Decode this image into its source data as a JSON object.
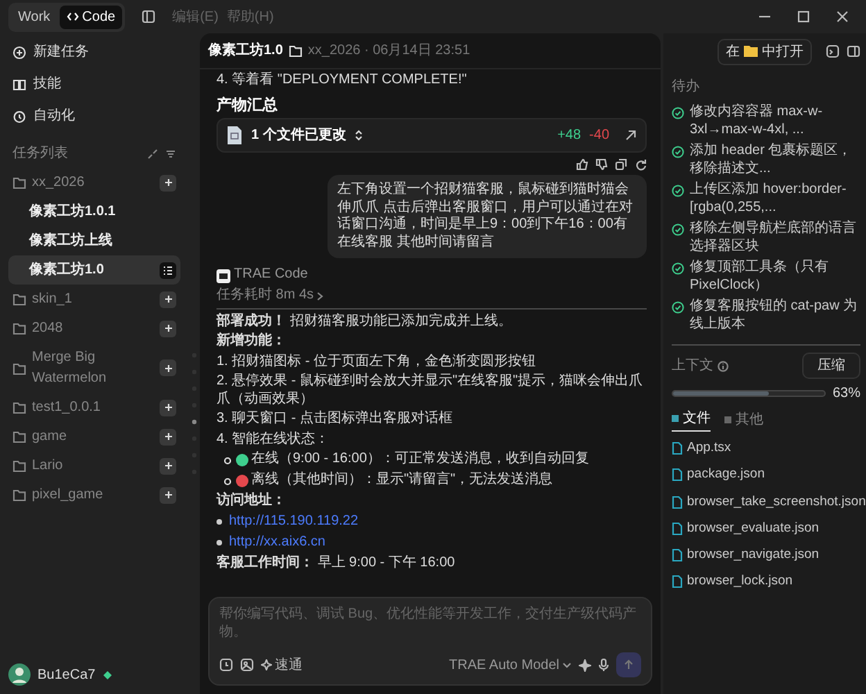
{
  "top_bar": {
    "mode_tabs": [
      {
        "label": "Work",
        "selected": false
      },
      {
        "label": "Code",
        "selected": true
      }
    ],
    "menu": [
      "编辑(E)",
      "帮助(H)"
    ]
  },
  "sidebar": {
    "actions": [
      {
        "label": "新建任务",
        "kind": "new"
      },
      {
        "label": "技能",
        "kind": "skills"
      },
      {
        "label": "自动化",
        "kind": "automation"
      }
    ],
    "task_list_title": "任务列表",
    "projects": [
      {
        "label": "xx_2026",
        "children": [
          {
            "label": "像素工坊1.0.1",
            "selected": false
          },
          {
            "label": "像素工坊上线",
            "selected": false
          },
          {
            "label": "像素工坊1.0",
            "selected": true
          }
        ]
      },
      {
        "label": "skin_1"
      },
      {
        "label": "2048"
      },
      {
        "label": "Merge Big Watermelon"
      },
      {
        "label": "test1_0.0.1"
      },
      {
        "label": "game"
      },
      {
        "label": "Lario"
      },
      {
        "label": "pixel_game"
      }
    ],
    "user": {
      "name": "Bu1eCa7"
    }
  },
  "task": {
    "title": "像素工坊1.0",
    "meta": "xx_2026 · 06月14日 23:51",
    "open_before": "在",
    "open_after": "中打开"
  },
  "conversation": {
    "earlier_step": "4. 等着看 \"DEPLOYMENT COMPLETE!\"",
    "summary": {
      "heading": "产物汇总",
      "files_changed": "1 个文件已更改",
      "added": "+48",
      "removed": "-40"
    },
    "user_message": "左下角设置一个招财猫客服，鼠标碰到猫时猫会伸爪爪 点击后弹出客服窗口，用户可以通过在对话窗口沟通，时间是早上9：00到下午16：00有在线客服 其他时间请留言",
    "assistant": {
      "name": "TRAE Code",
      "duration": "任务耗时 8m 4s",
      "success": "**部署成功！** 招财猫客服功能已添加完成并上线。",
      "features_heading": "新增功能：",
      "features": [
        "1. 招财猫图标 - 位于页面左下角，金色渐变圆形按钮",
        "2. 悬停效果 - 鼠标碰到时会放大并显示\"在线客服\"提示，猫咪会伸出爪爪（动画效果）",
        "3. 聊天窗口 - 点击图标弹出客服对话框",
        "4. 智能在线状态："
      ],
      "status_items": [
        {
          "text": "在线（9:00 - 16:00）：可正常发送消息，收到自动回复",
          "color": "#3ecf8e"
        },
        {
          "text": "离线（其他时间）：显示\"请留言\"，无法发送消息",
          "color": "#e5484d"
        }
      ],
      "access_heading": "访问地址：",
      "links": [
        "http://115.190.119.22",
        "http://xx.aix6.cn"
      ],
      "hours": "**客服工作时间：** 早上 9:00 - 下午 16:00"
    }
  },
  "composer": {
    "placeholder": "帮你编写代码、调试 Bug、优化性能等开发工作，交付生产级代码产物。",
    "skill": "速通",
    "model": "TRAE Auto Model",
    "send_disabled": true
  },
  "right_panel": {
    "todo_title": "待办",
    "todos": [
      {
        "text": "修改内容容器 max-w-3xl→max-w-4xl, ...",
        "done": true
      },
      {
        "text": "添加 header 包裹标题区，移除描述文...",
        "done": true
      },
      {
        "text": "上传区添加 hover:border-[rgba(0,255,...",
        "done": true
      },
      {
        "text": "移除左侧导航栏底部的语言选择器区块",
        "done": true
      },
      {
        "text": "修复顶部工具条（只有 PixelClock）",
        "done": true
      },
      {
        "text": "修复客服按钮的 cat-paw 为线上版本",
        "done": true
      }
    ],
    "context": {
      "label": "上下文",
      "compress": "压缩",
      "level": 0.63,
      "reading": "63%"
    },
    "tabs": [
      {
        "label": "文件",
        "selected": true
      },
      {
        "label": "其他",
        "selected": false
      }
    ],
    "files": [
      "App.tsx",
      "package.json",
      "browser_take_screenshot.json",
      "browser_evaluate.json",
      "browser_navigate.json",
      "browser_lock.json"
    ]
  }
}
